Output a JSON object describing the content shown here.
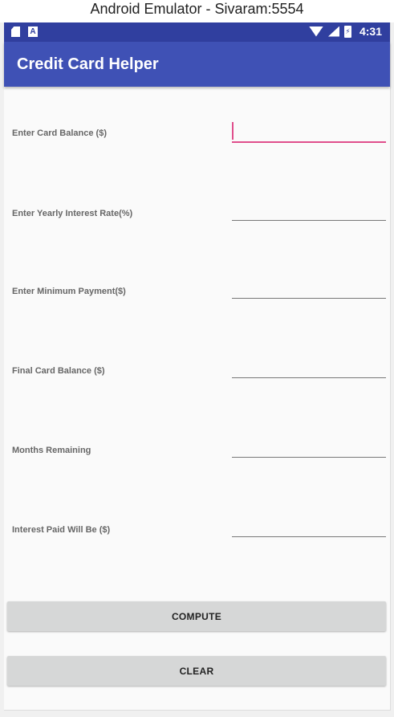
{
  "window": {
    "title": "Android Emulator - Sivaram:5554"
  },
  "status_bar": {
    "time": "4:31",
    "icons_left": [
      "sd-card-icon",
      "a-notification-icon"
    ],
    "icons_right": [
      "wifi-icon",
      "signal-icon",
      "battery-icon"
    ],
    "a_glyph": "A",
    "battery_glyph": "⚡"
  },
  "app_bar": {
    "title": "Credit Card Helper"
  },
  "form": {
    "fields": [
      {
        "label": "Enter Card Balance ($)",
        "value": "",
        "focused": true
      },
      {
        "label": "Enter Yearly Interest Rate(%)",
        "value": ""
      },
      {
        "label": "Enter Minimum Payment($)",
        "value": ""
      },
      {
        "label": "Final Card Balance ($)",
        "value": ""
      },
      {
        "label": "Months Remaining",
        "value": ""
      },
      {
        "label": "Interest Paid Will Be ($)",
        "value": ""
      }
    ]
  },
  "buttons": {
    "compute": "COMPUTE",
    "clear": "CLEAR"
  },
  "colors": {
    "status_bar": "#303f9f",
    "app_bar": "#3f51b5",
    "accent": "#e04e8c",
    "button": "#d6d7d7",
    "background": "#fafafa"
  }
}
